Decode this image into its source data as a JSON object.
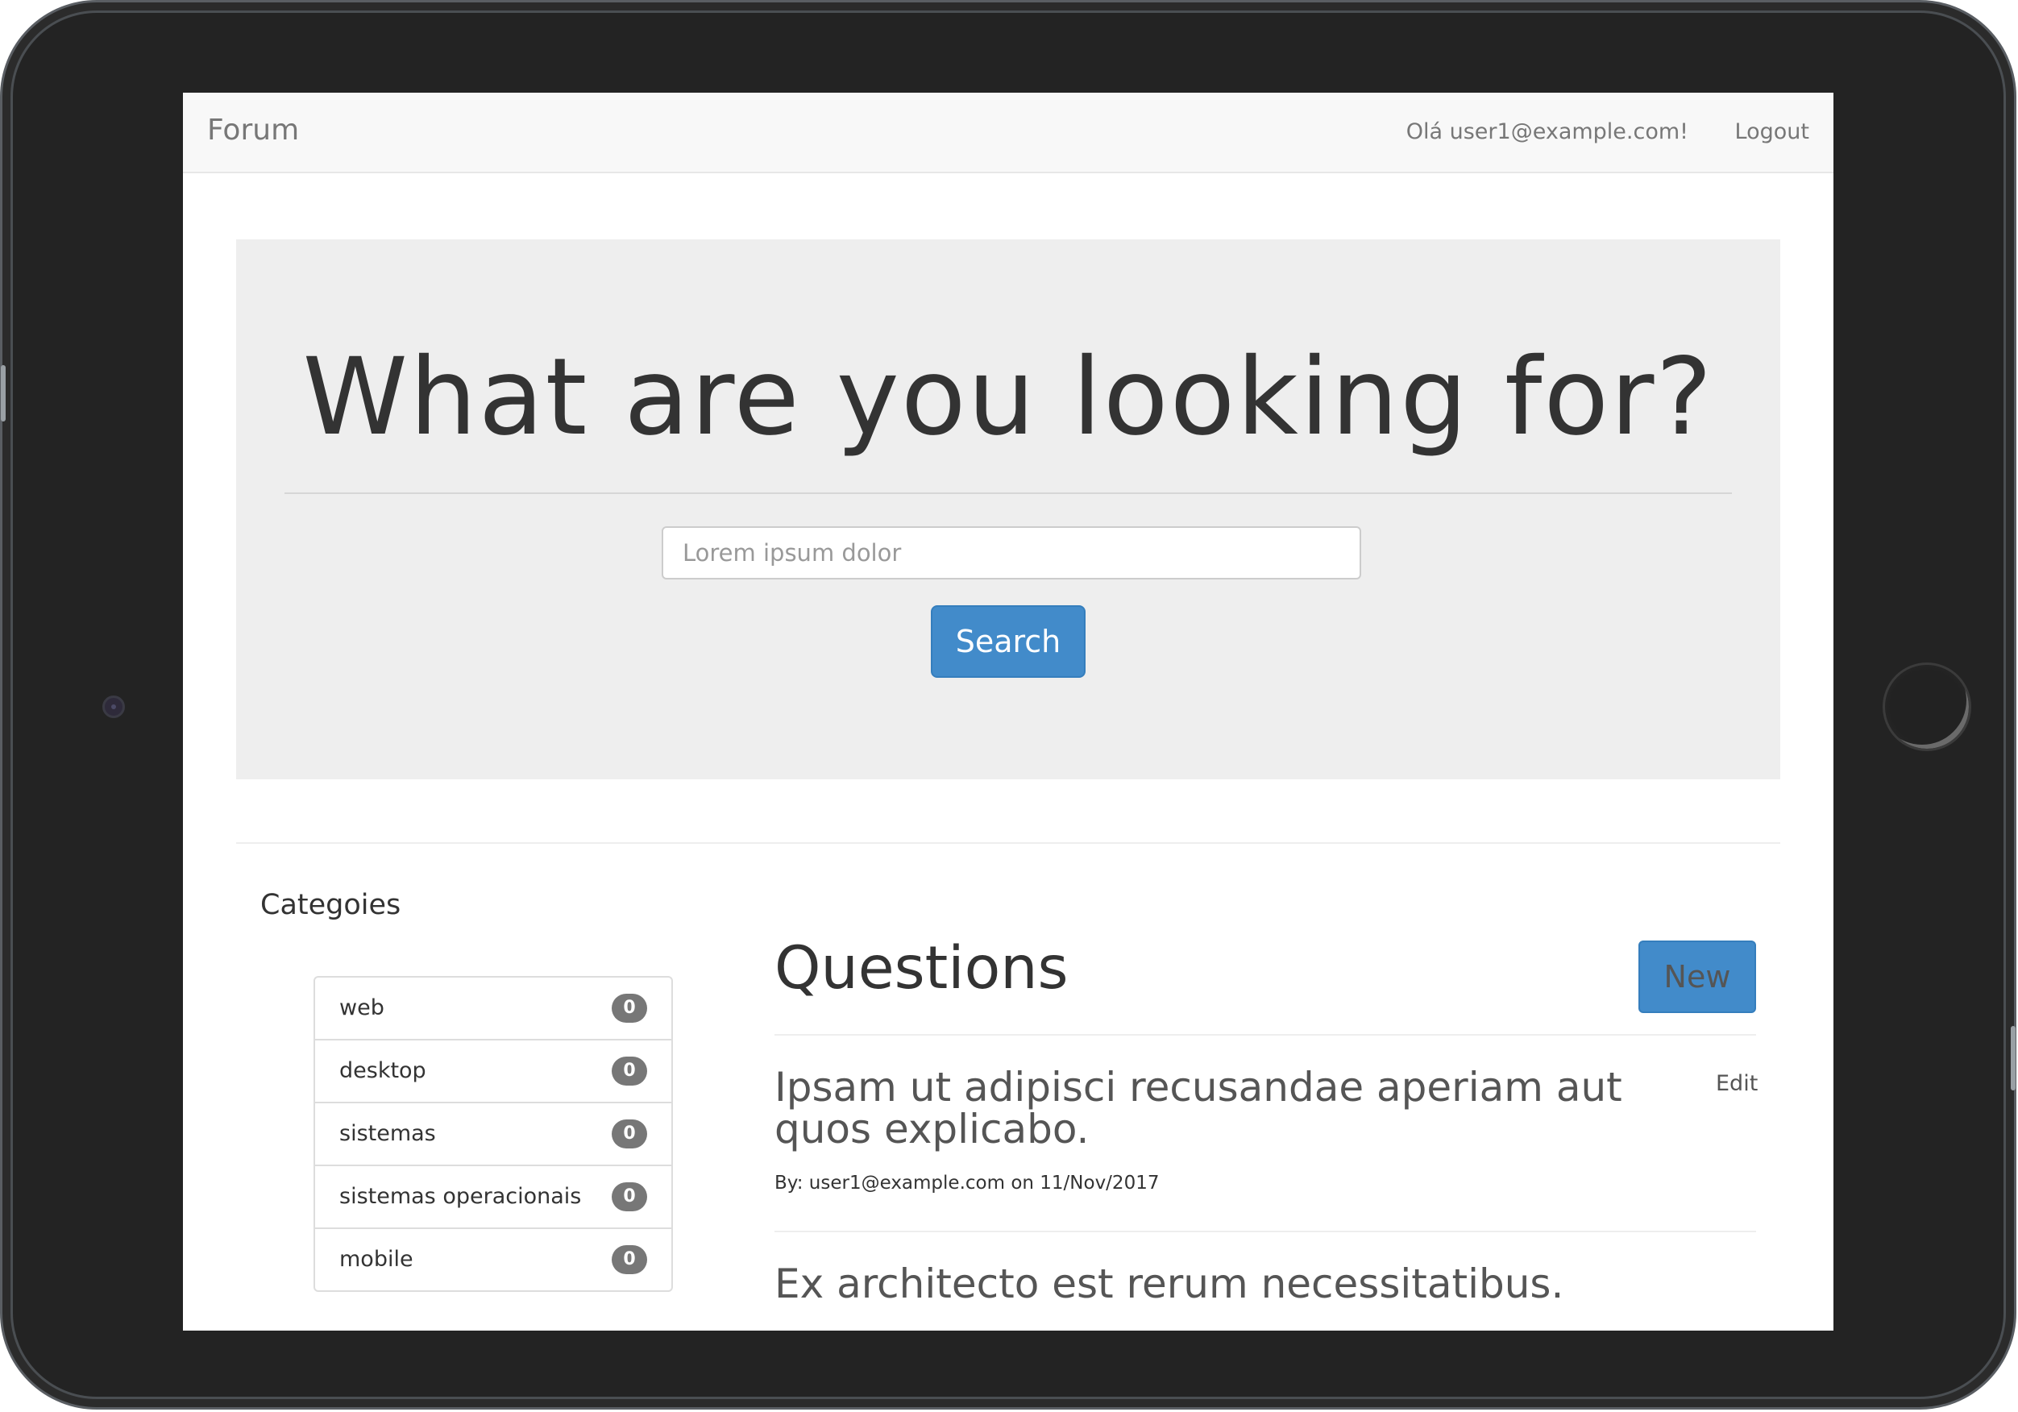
{
  "navbar": {
    "brand": "Forum",
    "greeting": "Olá user1@example.com!",
    "logout": "Logout"
  },
  "hero": {
    "title": "What are you looking for?",
    "search_placeholder": "Lorem ipsum dolor",
    "search_button": "Search"
  },
  "categories": {
    "heading": "Categoies",
    "items": [
      {
        "label": "web",
        "count": "0"
      },
      {
        "label": "desktop",
        "count": "0"
      },
      {
        "label": "sistemas",
        "count": "0"
      },
      {
        "label": "sistemas operacionais",
        "count": "0"
      },
      {
        "label": "mobile",
        "count": "0"
      }
    ]
  },
  "questions": {
    "heading": "Questions",
    "new_button": "New",
    "items": [
      {
        "title": "Ipsam ut adipisci recusandae aperiam aut quos explicabo.",
        "meta": "By: user1@example.com on 11/Nov/2017",
        "edit": "Edit"
      },
      {
        "title": "Ex architecto est rerum necessitatibus."
      }
    ]
  },
  "colors": {
    "primary": "#428bca",
    "badge": "#777777",
    "jumbotron": "#eeeeee",
    "device_frame": "#232323"
  },
  "icons": {
    "camera": "front-camera-icon",
    "home": "home-button-icon"
  }
}
